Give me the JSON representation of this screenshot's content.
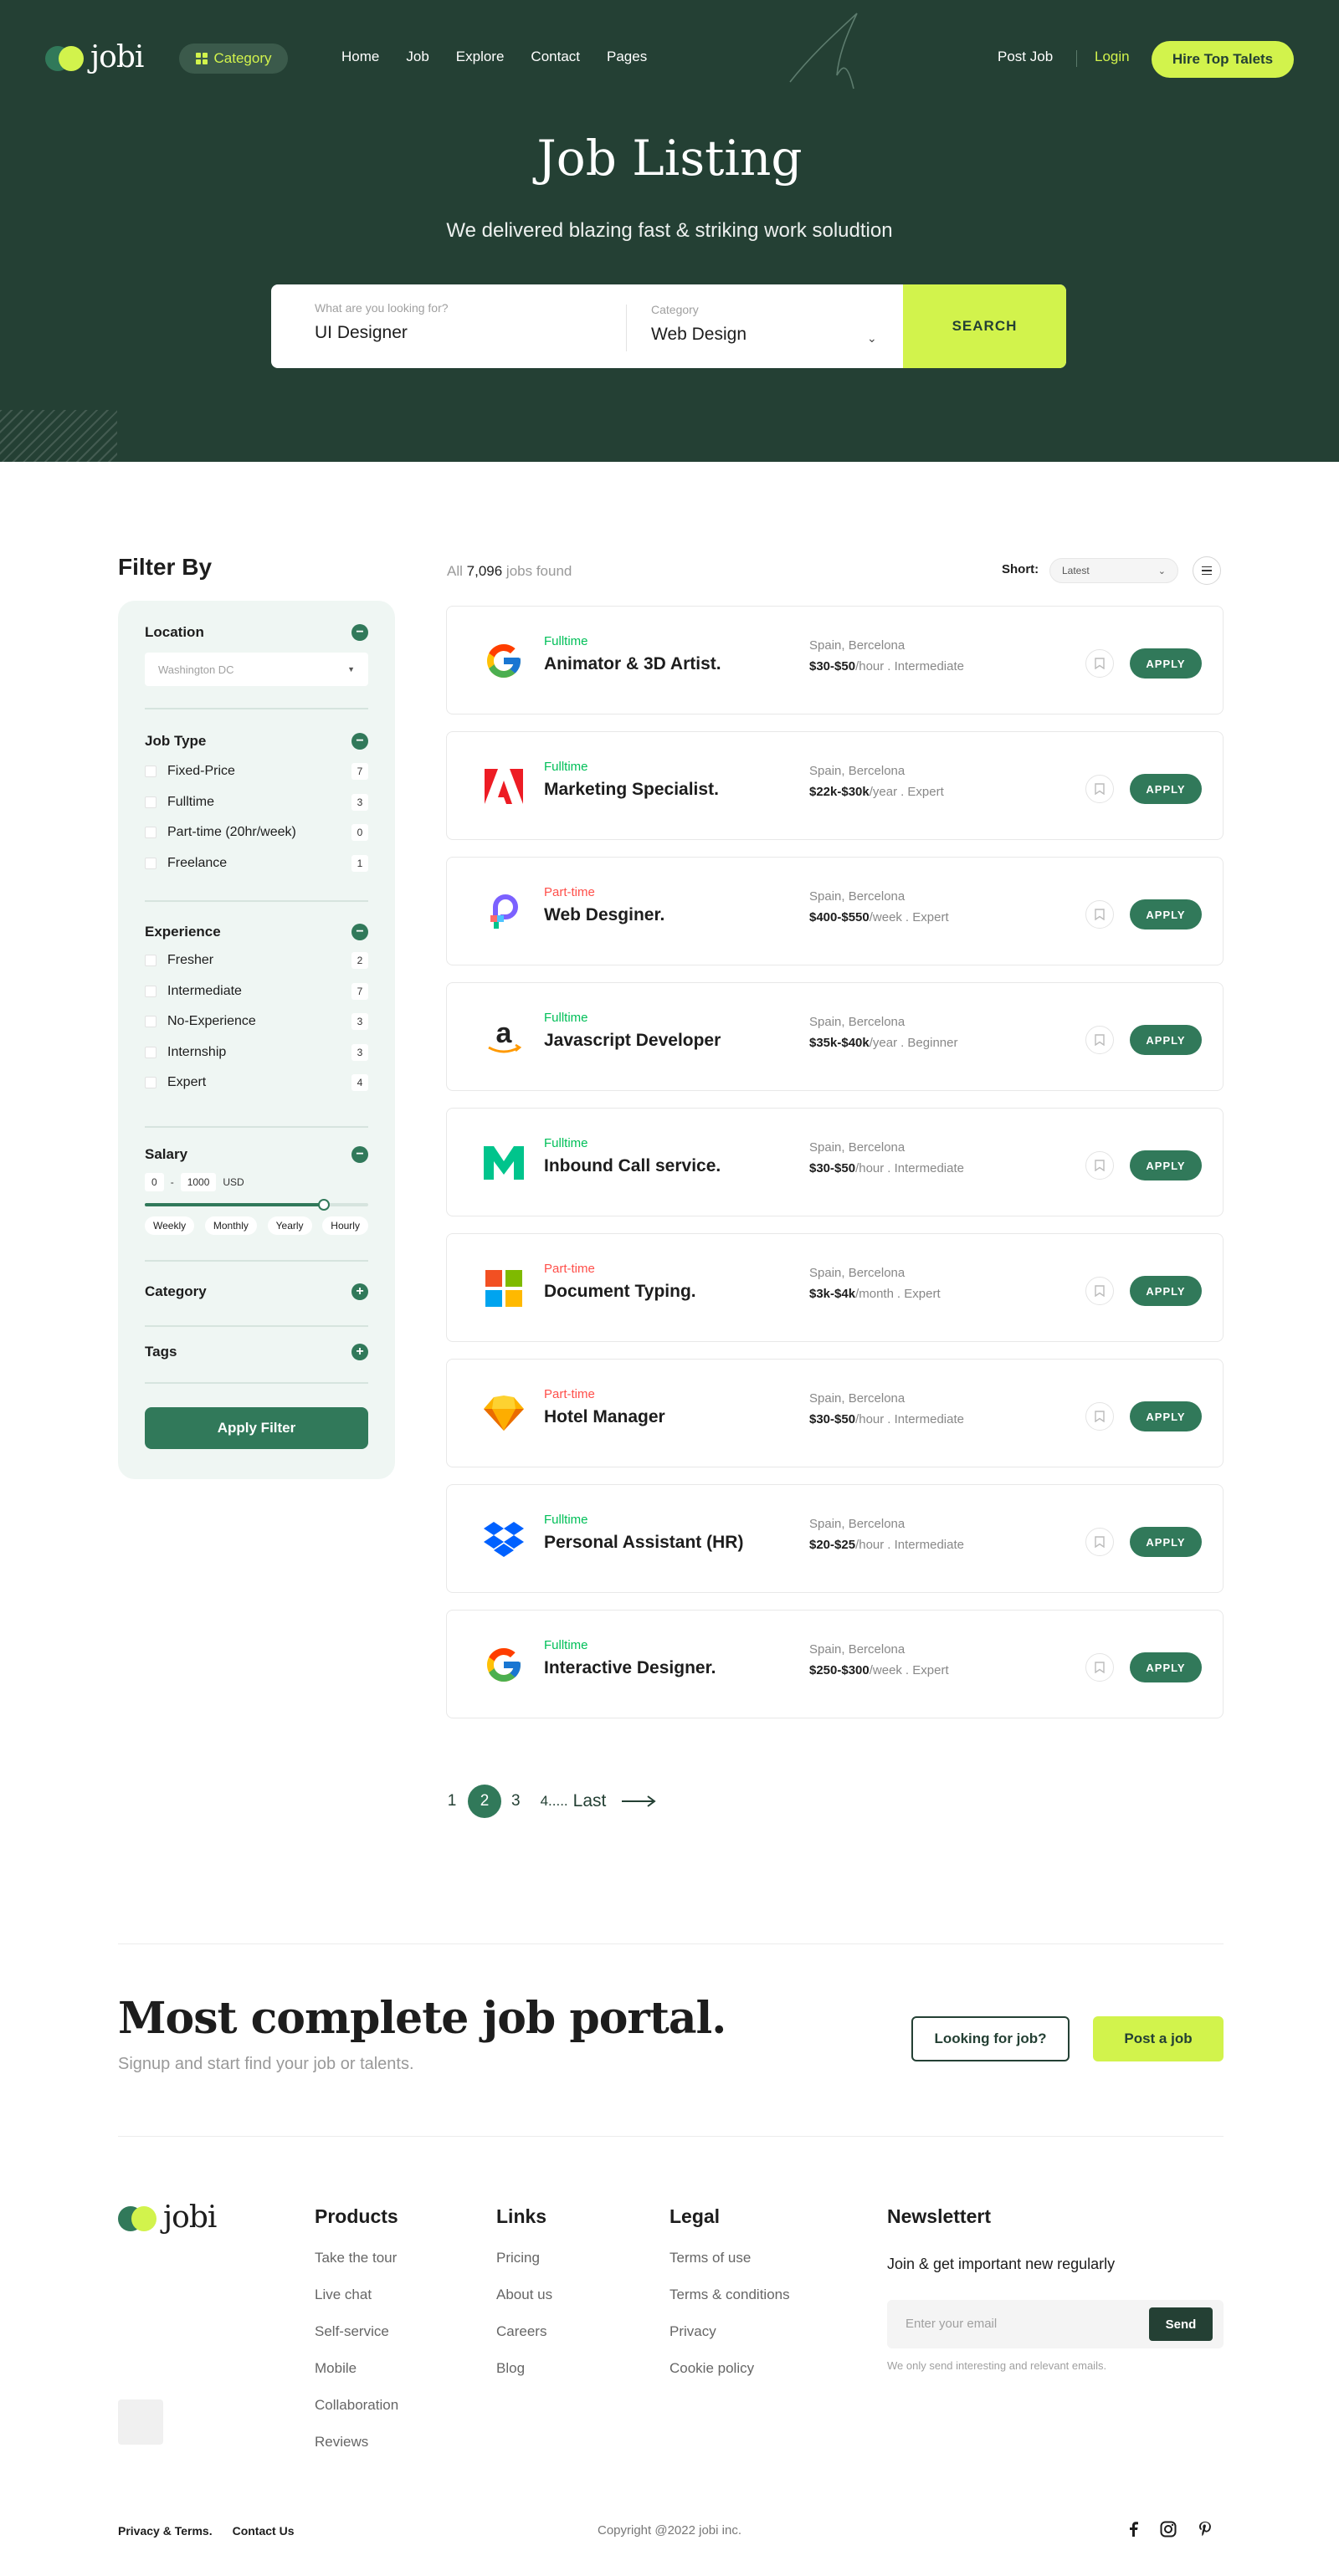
{
  "brand": {
    "name": "jobi",
    "accent": "#d2f34c",
    "primary": "#244034",
    "green": "#31795a"
  },
  "header": {
    "category_btn": "Category",
    "nav": [
      "Home",
      "Job",
      "Explore",
      "Contact",
      "Pages"
    ],
    "post_job": "Post Job",
    "login": "Login",
    "hire": "Hire Top Talets"
  },
  "hero": {
    "title": "Job Listing",
    "subtitle": "We delivered blazing fast & striking work soludtion",
    "search": {
      "keyword_label": "What are you looking for?",
      "keyword_value": "UI Designer",
      "category_label": "Category",
      "category_value": "Web Design",
      "button": "SEARCH"
    }
  },
  "filter": {
    "title": "Filter By",
    "location": {
      "label": "Location",
      "value": "Washington DC"
    },
    "job_type": {
      "label": "Job Type",
      "items": [
        {
          "label": "Fixed-Price",
          "count": "7"
        },
        {
          "label": "Fulltime",
          "count": "3"
        },
        {
          "label": "Part-time (20hr/week)",
          "count": "0"
        },
        {
          "label": "Freelance",
          "count": "1"
        }
      ]
    },
    "experience": {
      "label": "Experience",
      "items": [
        {
          "label": "Fresher",
          "count": "2"
        },
        {
          "label": "Intermediate",
          "count": "7"
        },
        {
          "label": "No-Experience",
          "count": "3"
        },
        {
          "label": "Internship",
          "count": "3"
        },
        {
          "label": "Expert",
          "count": "4"
        }
      ]
    },
    "salary": {
      "label": "Salary",
      "min": "0",
      "dash": "-",
      "max": "1000",
      "currency": "USD",
      "range_fraction": 0.8,
      "periods": [
        "Weekly",
        "Monthly",
        "Yearly",
        "Hourly"
      ]
    },
    "category": {
      "label": "Category"
    },
    "tags": {
      "label": "Tags"
    },
    "apply": "Apply Filter"
  },
  "results": {
    "prefix": "All",
    "count": "7,096",
    "suffix": "jobs found",
    "sort_label": "Short:",
    "sort_value": "Latest"
  },
  "jobs": [
    {
      "type": "Fulltime",
      "kind": "full",
      "title": "Animator & 3D Artist.",
      "location": "Spain, Bercelona",
      "pay": "$30-$50",
      "period": "/hour",
      "level": ". Intermediate",
      "logo": "google-logo",
      "apply": "APPLY"
    },
    {
      "type": "Fulltime",
      "kind": "full",
      "title": "Marketing Specialist.",
      "location": "Spain, Bercelona",
      "pay": "$22k-$30k",
      "period": "/year",
      "level": ". Expert",
      "logo": "adobe-logo",
      "apply": "APPLY"
    },
    {
      "type": "Part-time",
      "kind": "part",
      "title": "Web Desginer.",
      "location": "Spain, Bercelona",
      "pay": "$400-$550",
      "period": "/week",
      "level": ". Expert",
      "logo": "p-logo",
      "apply": "APPLY"
    },
    {
      "type": "Fulltime",
      "kind": "full",
      "title": "Javascript Developer",
      "location": "Spain, Bercelona",
      "pay": "$35k-$40k",
      "period": "/year",
      "level": ". Beginner",
      "logo": "amazon-logo",
      "apply": "APPLY"
    },
    {
      "type": "Fulltime",
      "kind": "full",
      "title": "Inbound Call service.",
      "location": "Spain, Bercelona",
      "pay": "$30-$50",
      "period": "/hour",
      "level": ". Intermediate",
      "logo": "m-logo",
      "apply": "APPLY"
    },
    {
      "type": "Part-time",
      "kind": "part",
      "title": "Document Typing.",
      "location": "Spain, Bercelona",
      "pay": "$3k-$4k",
      "period": "/month",
      "level": ". Expert",
      "logo": "microsoft-logo",
      "apply": "APPLY"
    },
    {
      "type": "Part-time",
      "kind": "part",
      "title": "Hotel Manager",
      "location": "Spain, Bercelona",
      "pay": "$30-$50",
      "period": "/hour",
      "level": ". Intermediate",
      "logo": "sketch-logo",
      "apply": "APPLY"
    },
    {
      "type": "Fulltime",
      "kind": "full",
      "title": "Personal Assistant (HR)",
      "location": "Spain, Bercelona",
      "pay": "$20-$25",
      "period": "/hour",
      "level": ". Intermediate",
      "logo": "dropbox-logo",
      "apply": "APPLY"
    },
    {
      "type": "Fulltime",
      "kind": "full",
      "title": "Interactive Designer.",
      "location": "Spain, Bercelona",
      "pay": "$250-$300",
      "period": "/week",
      "level": ". Expert",
      "logo": "google-logo",
      "apply": "APPLY"
    }
  ],
  "pagination": {
    "pages": [
      "1",
      "2",
      "3",
      "4....."
    ],
    "active": "2",
    "last": "Last"
  },
  "cta": {
    "title": "Most complete job portal.",
    "subtitle": "Signup and start find your job or talents.",
    "looking": "Looking for job?",
    "post": "Post a job"
  },
  "footer": {
    "columns": [
      {
        "title": "Products",
        "links": [
          "Take the tour",
          "Live chat",
          "Self-service",
          "Mobile",
          "Collaboration",
          "Reviews"
        ]
      },
      {
        "title": "Links",
        "links": [
          "Pricing",
          "About us",
          "Careers",
          "Blog"
        ]
      },
      {
        "title": "Legal",
        "links": [
          "Terms of use",
          "Terms & conditions",
          "Privacy",
          "Cookie policy"
        ]
      }
    ],
    "newsletter": {
      "title": "Newslettert",
      "subtitle": "Join & get important new regularly",
      "placeholder": "Enter your email",
      "button": "Send",
      "note": "We only send interesting and relevant emails."
    },
    "bottom_links": [
      "Privacy & Terms.",
      "Contact Us"
    ],
    "copyright": "Copyright @2022 jobi inc.",
    "socials": [
      "facebook-icon",
      "instagram-icon",
      "pinterest-icon"
    ]
  }
}
